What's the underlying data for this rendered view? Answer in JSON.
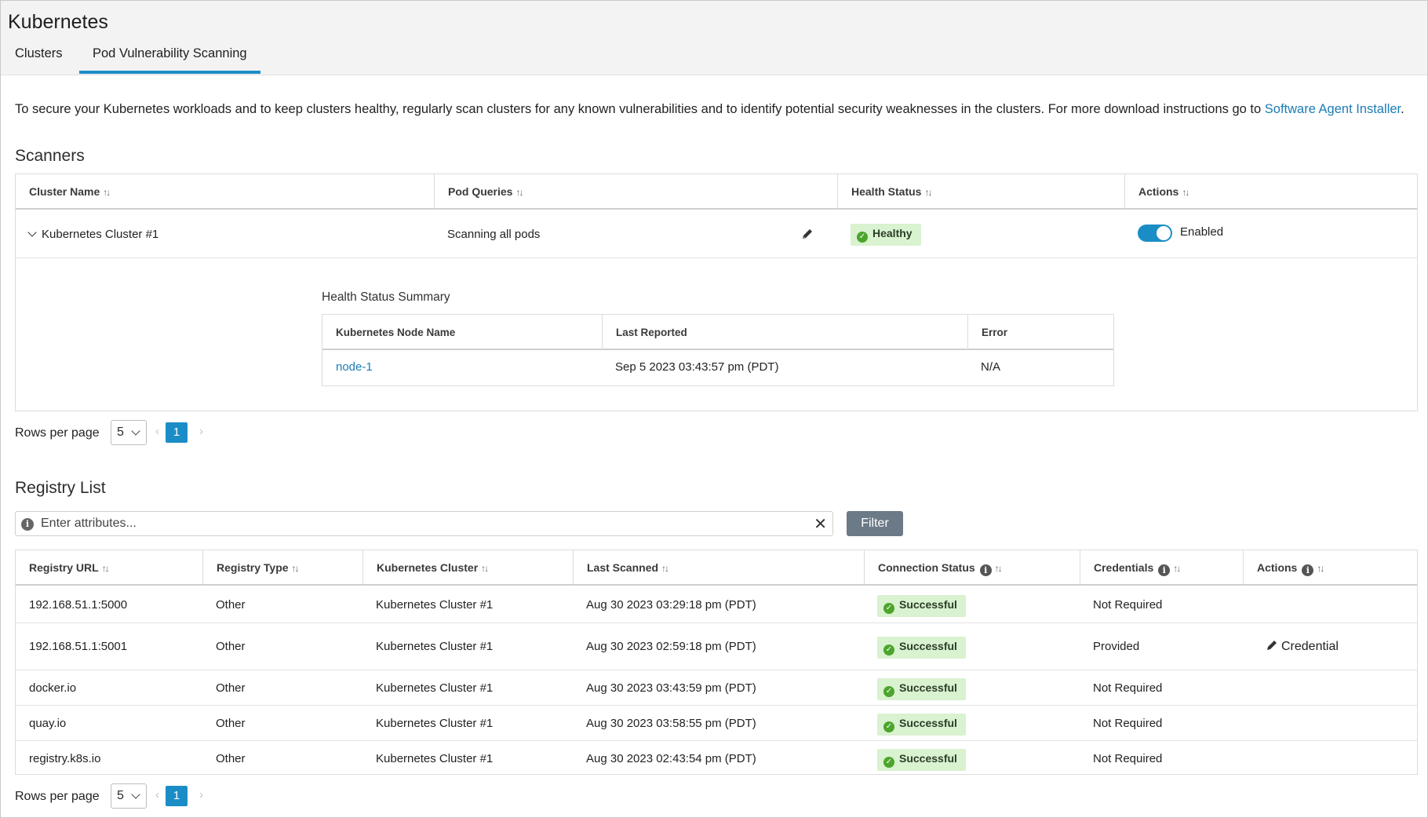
{
  "app_title": "Kubernetes",
  "tabs": [
    {
      "label": "Clusters"
    },
    {
      "label": "Pod Vulnerability Scanning"
    }
  ],
  "description": {
    "text": "To secure your Kubernetes workloads and to keep clusters healthy, regularly scan clusters for any known vulnerabilities and to identify potential security weaknesses in the clusters. For more download instructions go to ",
    "link": "Software Agent Installer",
    "suffix": "."
  },
  "scanners": {
    "title": "Scanners",
    "columns": [
      "Cluster Name",
      "Pod Queries",
      "Health Status",
      "Actions"
    ],
    "row": {
      "cluster_name": "Kubernetes Cluster #1",
      "pod_queries": "Scanning all pods",
      "health_status": "Healthy",
      "action_label": "Enabled"
    },
    "summary": {
      "title": "Health Status Summary",
      "columns": [
        "Kubernetes Node Name",
        "Last Reported",
        "Error"
      ],
      "row": {
        "node": "node-1",
        "last_reported": "Sep 5 2023 03:43:57 pm (PDT)",
        "error": "N/A"
      }
    },
    "pagination": {
      "rows_label": "Rows per page",
      "rows_value": "5",
      "page": "1"
    }
  },
  "registry": {
    "title": "Registry List",
    "filter_placeholder": "Enter attributes...",
    "filter_button": "Filter",
    "columns": [
      "Registry URL",
      "Registry Type",
      "Kubernetes Cluster",
      "Last Scanned",
      "Connection Status",
      "Credentials",
      "Actions"
    ],
    "rows": [
      {
        "url": "192.168.51.1:5000",
        "type": "Other",
        "cluster": "Kubernetes Cluster #1",
        "last_scanned": "Aug 30 2023 03:29:18 pm (PDT)",
        "status": "Successful",
        "credentials": "Not Required",
        "action": ""
      },
      {
        "url": "192.168.51.1:5001",
        "type": "Other",
        "cluster": "Kubernetes Cluster #1",
        "last_scanned": "Aug 30 2023 02:59:18 pm (PDT)",
        "status": "Successful",
        "credentials": "Provided",
        "action": "Credential"
      },
      {
        "url": "docker.io",
        "type": "Other",
        "cluster": "Kubernetes Cluster #1",
        "last_scanned": "Aug 30 2023 03:43:59 pm (PDT)",
        "status": "Successful",
        "credentials": "Not Required",
        "action": ""
      },
      {
        "url": "quay.io",
        "type": "Other",
        "cluster": "Kubernetes Cluster #1",
        "last_scanned": "Aug 30 2023 03:58:55 pm (PDT)",
        "status": "Successful",
        "credentials": "Not Required",
        "action": ""
      },
      {
        "url": "registry.k8s.io",
        "type": "Other",
        "cluster": "Kubernetes Cluster #1",
        "last_scanned": "Aug 30 2023 02:43:54 pm (PDT)",
        "status": "Successful",
        "credentials": "Not Required",
        "action": ""
      }
    ],
    "pagination": {
      "rows_label": "Rows per page",
      "rows_value": "5",
      "page": "1"
    }
  },
  "icons": {
    "sort": "sort-icon",
    "info": "info-icon",
    "edit": "pencil-icon",
    "check": "check-circle-icon",
    "close": "close-icon"
  },
  "colors": {
    "accent": "#1b8dc6",
    "success_bg": "#d9f2d0",
    "success_icon": "#4ca52c",
    "link": "#1b7cb5"
  }
}
